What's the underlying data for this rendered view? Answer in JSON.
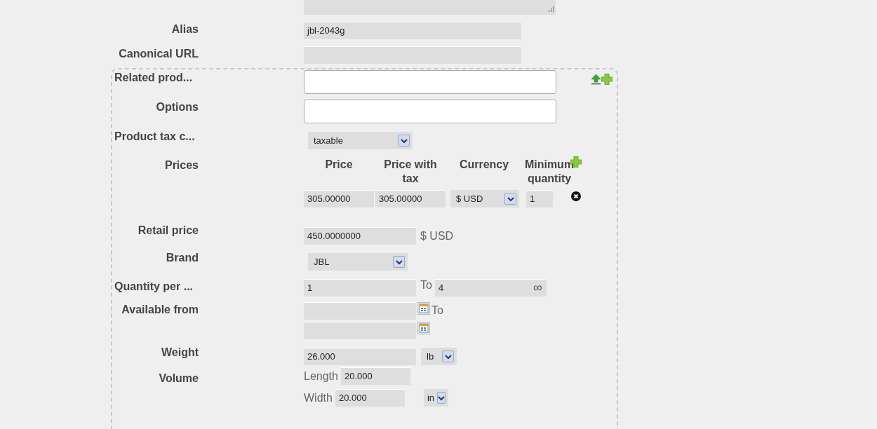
{
  "top_rows": [
    {
      "kind": "textarea"
    },
    {
      "kind": "text",
      "label": "Alias",
      "value": "jbl-2043g"
    },
    {
      "kind": "text",
      "label": "Canonical URL"
    }
  ],
  "panel": {
    "rows": [
      {
        "kind": "input",
        "label": "Related prod...",
        "truncated": true
      },
      {
        "kind": "input",
        "label": "Options",
        "truncated": false
      },
      {
        "kind": "select",
        "label": "Product tax c...",
        "truncated": true,
        "value": "taxable"
      },
      {
        "kind": "prices",
        "label": "Prices",
        "truncated": false,
        "columns": [
          "Price",
          "Price with tax",
          "Currency",
          "Minimum quantity"
        ],
        "rows": [
          {
            "price": "305.00000",
            "price_with_tax": "305.00000",
            "currency": "$ USD",
            "min_quantity": "1"
          }
        ]
      },
      {
        "kind": "money",
        "label": "Retail price",
        "truncated": false,
        "value": "450.0000000",
        "suffix": "$ USD"
      },
      {
        "kind": "select",
        "label": "Brand",
        "truncated": false,
        "value": "JBL"
      },
      {
        "kind": "range",
        "label": "Quantity per ...",
        "truncated": true,
        "from": "1",
        "to_label": "To",
        "to": "4",
        "infinity": "∞"
      },
      {
        "kind": "dates",
        "label": "Available from",
        "truncated": false,
        "to_label": "To"
      },
      {
        "kind": "unit",
        "label": "Weight",
        "truncated": false,
        "value": "26.000",
        "unit": "lb"
      },
      {
        "kind": "volume",
        "label": "Volume",
        "truncated": false,
        "dims": [
          {
            "label": "Length",
            "value": "20.000"
          },
          {
            "label": "Width",
            "value": "20.000",
            "unit": "in"
          }
        ]
      }
    ]
  }
}
